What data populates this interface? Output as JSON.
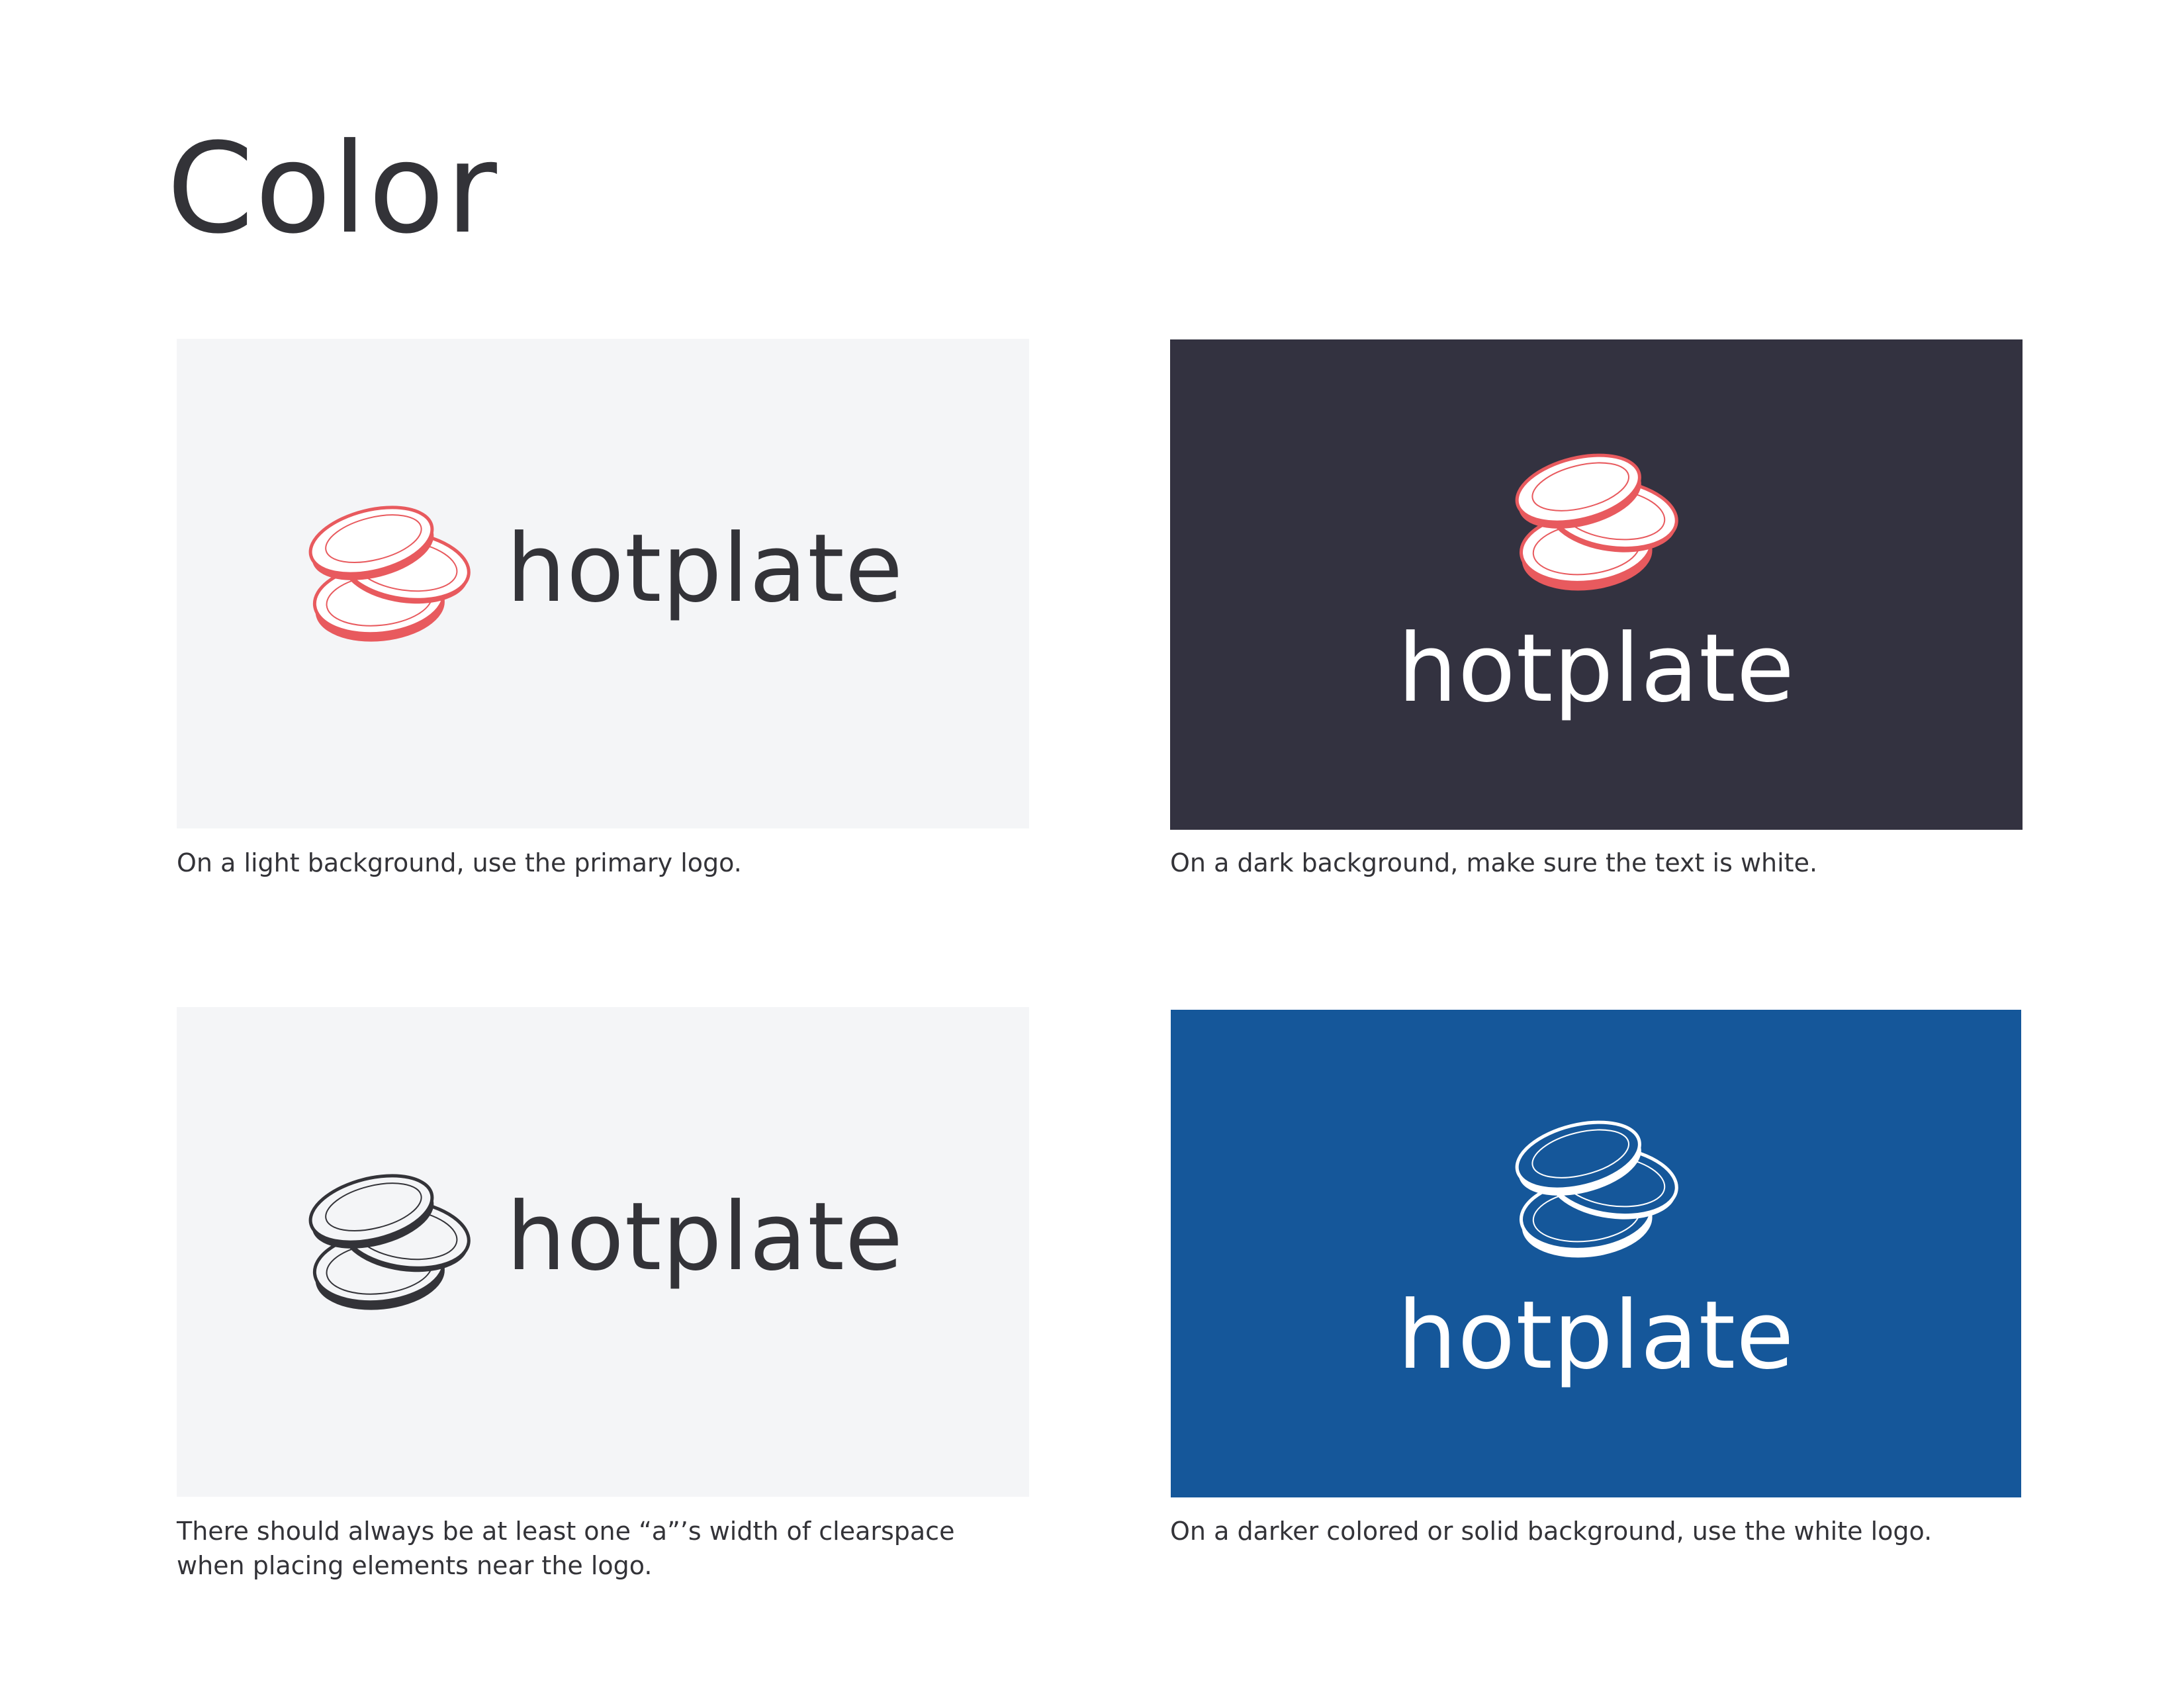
{
  "page": {
    "title": "Color"
  },
  "panels": [
    {
      "background": "#f4f5f7",
      "logo": {
        "text": "hotplate",
        "text_color": "#333338",
        "mark_fill": "#e85a5e",
        "mark_inner": "#ffffff",
        "mark_line": "#e85a5e",
        "mark_icon": "hotplate-plates-icon"
      },
      "caption": "On a light background, use the primary logo."
    },
    {
      "background": "#333240",
      "logo": {
        "text": "hotplate",
        "text_color": "#ffffff",
        "mark_fill": "#e85a5e",
        "mark_inner": "#ffffff",
        "mark_line": "#e85a5e",
        "mark_icon": "hotplate-plates-icon"
      },
      "caption": "On a dark background, make sure the text is white."
    },
    {
      "background": "#f4f5f7",
      "logo": {
        "text": "hotplate",
        "text_color": "#333338",
        "mark_fill": "#333338",
        "mark_inner": "#f4f5f7",
        "mark_line": "#333338",
        "mark_icon": "hotplate-plates-icon"
      },
      "caption_lines": [
        "There should always be at least one “a”’s width of clearspace",
        "when placing elements near the logo."
      ]
    },
    {
      "background": "#15579a",
      "logo": {
        "text": "hotplate",
        "text_color": "#ffffff",
        "mark_fill": "#ffffff",
        "mark_inner": "#15579a",
        "mark_line": "#ffffff",
        "mark_icon": "hotplate-plates-icon"
      },
      "caption": "On a darker colored or solid background, use the white logo."
    }
  ]
}
